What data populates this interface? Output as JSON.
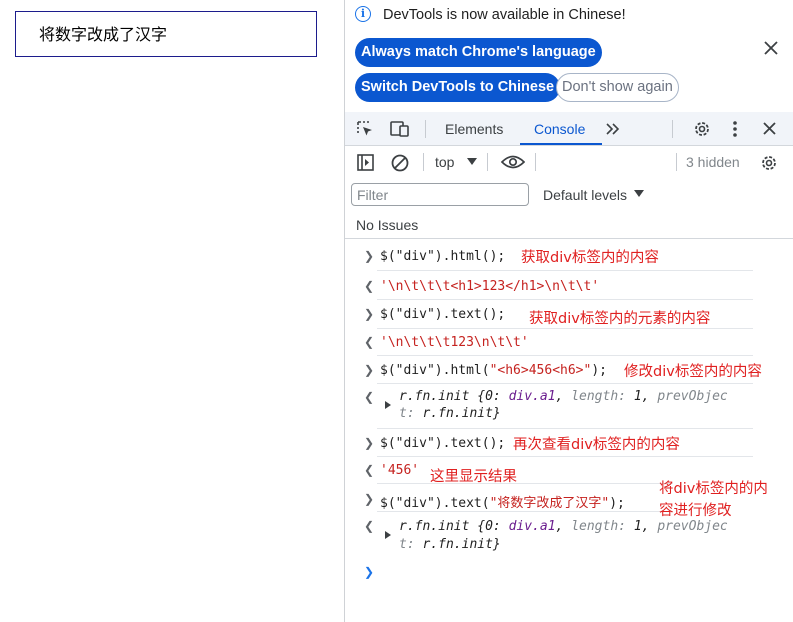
{
  "page": {
    "div_text": "将数字改成了汉字"
  },
  "infobar": {
    "message": "DevTools is now available in Chinese!",
    "btn_match": "Always match Chrome's language",
    "btn_switch": "Switch DevTools to Chinese",
    "btn_dont_show": "Don't show again"
  },
  "tabs": {
    "elements": "Elements",
    "console": "Console"
  },
  "toolbar": {
    "context": "top",
    "hidden": "3 hidden",
    "filter_placeholder": "Filter",
    "levels": "Default levels",
    "no_issues": "No Issues"
  },
  "console": {
    "l1": {
      "code": "$(\"div\").html();",
      "note": "获取div标签内的内容"
    },
    "l2": {
      "value": "'\\n\\t\\t\\t<h1>123</h1>\\n\\t\\t'"
    },
    "l3": {
      "code": "$(\"div\").text();",
      "note": "获取div标签内的元素的内容"
    },
    "l4": {
      "value": "'\\n\\t\\t\\t123\\n\\t\\t'"
    },
    "l5": {
      "code": "$(\"div\").html(\"<h6>456<h6>\");",
      "note": "修改div标签内的内容"
    },
    "l6": {
      "line1": "r.fn.init {0: div.a1, length: 1, prevObjec",
      "line2": "t: r.fn.init}"
    },
    "l7": {
      "code": "$(\"div\").text();",
      "note": "再次查看div标签内的内容"
    },
    "l8": {
      "value": "'456'",
      "note": "这里显示结果"
    },
    "l9": {
      "code": "$(\"div\").text(\"将数字改成了汉字\");",
      "note_line1": "将div标签内的内",
      "note_line2": "容进行修改"
    },
    "l10": {
      "line1": "r.fn.init {0: div.a1, length: 1, prevObjec",
      "line2": "t: r.fn.init}"
    }
  },
  "colors": {
    "accent": "#0b57d0",
    "note": "#e02020",
    "string": "#c5221f"
  },
  "icons": [
    "info-icon",
    "close-icon",
    "inspect-element-icon",
    "device-toolbar-icon",
    "more-tabs-icon",
    "settings-gear-icon",
    "kebab-menu-icon",
    "sidebar-toggle-icon",
    "clear-console-icon",
    "dropdown-caret-icon",
    "eye-icon",
    "console-settings-gear-icon",
    "input-chevron-icon",
    "output-arrow-icon"
  ]
}
